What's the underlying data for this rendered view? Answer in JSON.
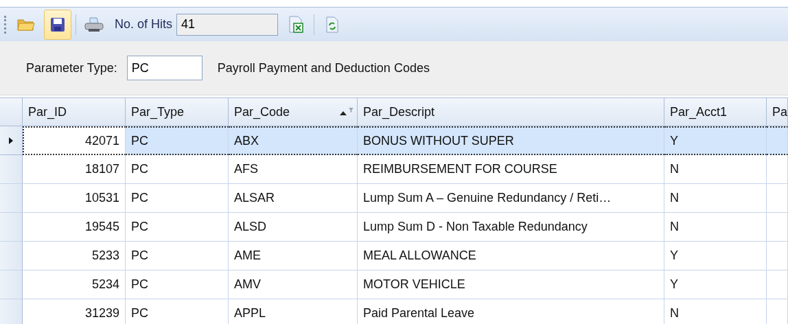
{
  "toolbar": {
    "items": [
      {
        "kind": "open",
        "highlighted": false
      },
      {
        "kind": "save",
        "highlighted": true
      },
      {
        "kind": "print",
        "highlighted": false
      }
    ],
    "hits_label": "No. of Hits",
    "hits_value": "41",
    "actions": [
      {
        "kind": "excel"
      },
      {
        "kind": "refresh"
      }
    ]
  },
  "filter": {
    "label": "Parameter Type:",
    "value": "PC",
    "description": "Payroll Payment and Deduction Codes"
  },
  "table": {
    "columns": [
      {
        "label": "Par_ID",
        "sorted": false
      },
      {
        "label": "Par_Type",
        "sorted": false
      },
      {
        "label": "Par_Code",
        "sorted": true
      },
      {
        "label": "Par_Descript",
        "sorted": false
      },
      {
        "label": "Par_Acct1",
        "sorted": false
      },
      {
        "label": "Pa",
        "sorted": false
      }
    ],
    "rows": [
      {
        "selected": true,
        "cells": [
          "42071",
          "PC",
          "ABX",
          "BONUS WITHOUT SUPER",
          "Y"
        ]
      },
      {
        "selected": false,
        "cells": [
          "18107",
          "PC",
          "AFS",
          "REIMBURSEMENT FOR COURSE",
          "N"
        ]
      },
      {
        "selected": false,
        "cells": [
          "10531",
          "PC",
          "ALSAR",
          "Lump Sum A – Genuine Redundancy / Reti…",
          "N"
        ]
      },
      {
        "selected": false,
        "cells": [
          "19545",
          "PC",
          "ALSD",
          "Lump Sum D - Non Taxable Redundancy",
          "N"
        ]
      },
      {
        "selected": false,
        "cells": [
          "5233",
          "PC",
          "AME",
          "MEAL ALLOWANCE",
          "Y"
        ]
      },
      {
        "selected": false,
        "cells": [
          "5234",
          "PC",
          "AMV",
          "MOTOR VEHICLE",
          "Y"
        ]
      },
      {
        "selected": false,
        "cells": [
          "31239",
          "PC",
          "APPL",
          "Paid Parental Leave",
          "N"
        ]
      }
    ]
  }
}
